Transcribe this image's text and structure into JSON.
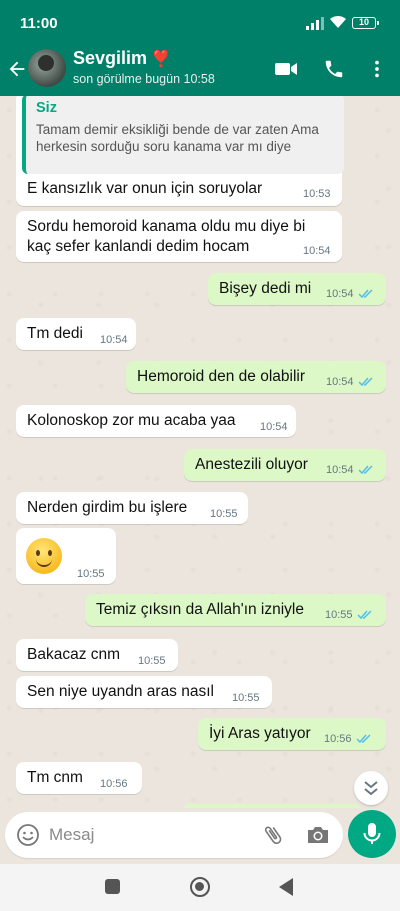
{
  "status_bar": {
    "time": "11:00",
    "battery": "10"
  },
  "header": {
    "contact_name": "Sevgilim",
    "heart": "❣️",
    "last_seen": "son görülme bugün 10:58"
  },
  "messages": [
    {
      "dir": "in",
      "reply_to": {
        "sender": "Siz",
        "text": "Tamam demir eksikliği bende de var zaten Ama herkesin sorduğu soru kanama var mı diye"
      },
      "text": "E kansızlık var onun için soruyolar",
      "time": "10:53"
    },
    {
      "dir": "in",
      "lines": [
        "Sordu hemoroid kanama oldu mu diye bi",
        "kaç sefer kanlandi dedim hocam"
      ],
      "time": "10:54"
    },
    {
      "dir": "out",
      "text": "Bişey dedi mi",
      "time": "10:54",
      "read": true
    },
    {
      "dir": "in",
      "text": "Tm dedi",
      "time": "10:54"
    },
    {
      "dir": "out",
      "text": "Hemoroid den de olabilir",
      "time": "10:54",
      "read": true
    },
    {
      "dir": "in",
      "text": "Kolonoskop zor mu acaba yaa",
      "time": "10:54"
    },
    {
      "dir": "out",
      "text": "Anestezili oluyor",
      "time": "10:54",
      "read": true
    },
    {
      "dir": "in",
      "text": "Nerden girdim bu işlere",
      "time": "10:55"
    },
    {
      "dir": "in",
      "emoji": "smiling-face-emoji",
      "time": "10:55"
    },
    {
      "dir": "out",
      "text": "Temiz çıksın da Allah'ın izniyle",
      "time": "10:55",
      "read": true
    },
    {
      "dir": "in",
      "text": "Bakacaz cnm",
      "time": "10:55"
    },
    {
      "dir": "in",
      "text": "Sen niye uyandn aras nasıl",
      "time": "10:55"
    },
    {
      "dir": "out",
      "text": "İyi Aras yatıyor",
      "time": "10:56",
      "read": true
    },
    {
      "dir": "in",
      "text": "Tm cnm",
      "time": "10:56"
    }
  ],
  "composer": {
    "placeholder": "Mesaj"
  },
  "colors": {
    "header_bg": "#008069",
    "outgoing_bubble": "#dcf8c6",
    "incoming_bubble": "#ffffff",
    "read_ticks": "#53bdeb",
    "mic_button": "#00a884"
  }
}
